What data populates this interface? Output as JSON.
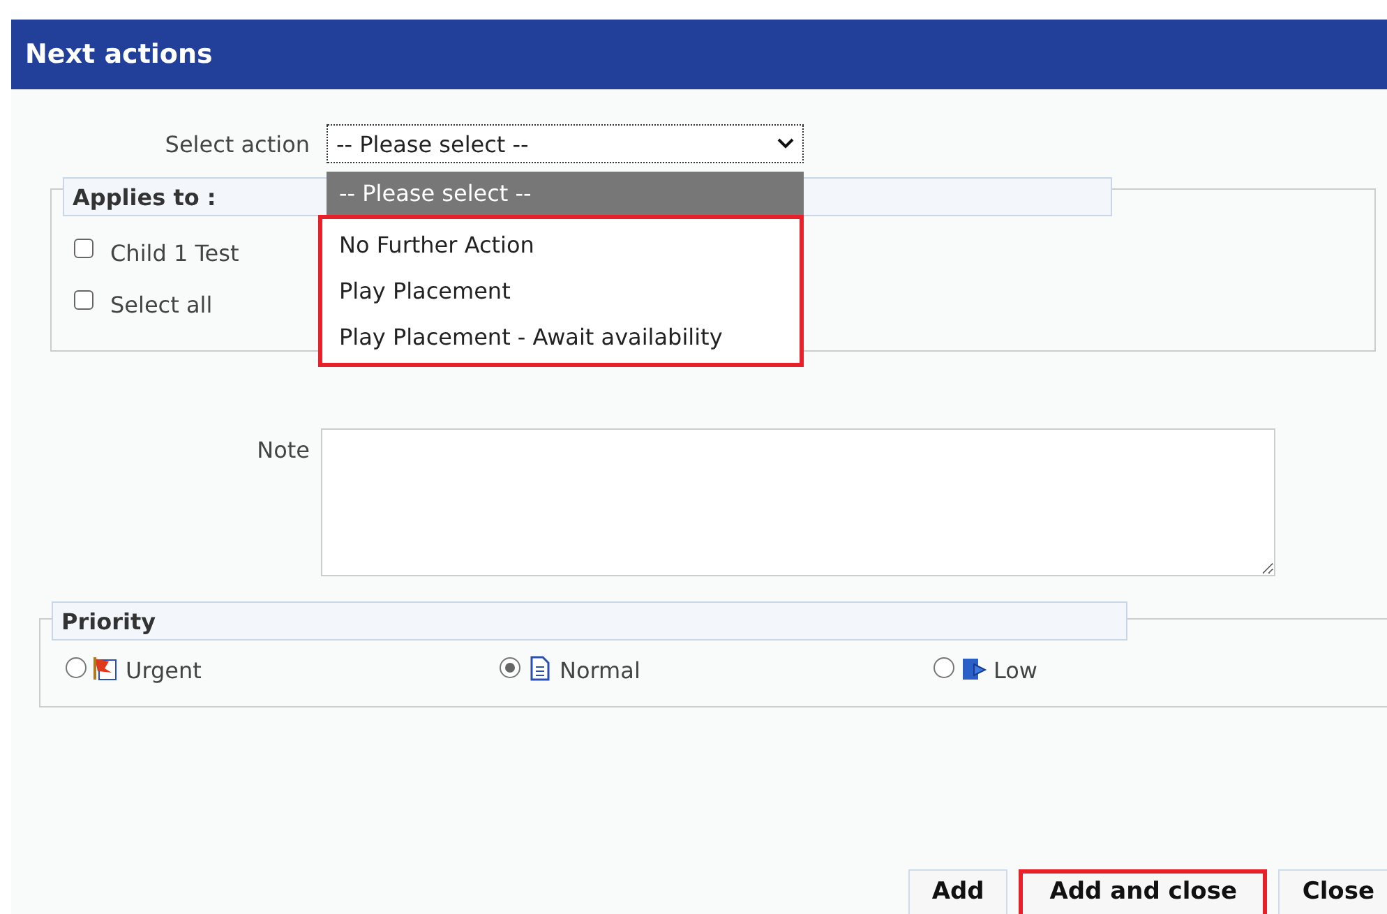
{
  "window": {
    "title": "Next actions"
  },
  "select_action": {
    "label": "Select action",
    "value": "-- Please select --",
    "expanded": true,
    "options": [
      {
        "label": "-- Please select --",
        "selected": true,
        "highlighted": false
      },
      {
        "label": "No Further Action",
        "selected": false,
        "highlighted": true
      },
      {
        "label": "Play Placement",
        "selected": false,
        "highlighted": true
      },
      {
        "label": "Play Placement - Await availability",
        "selected": false,
        "highlighted": true
      }
    ]
  },
  "applies_to": {
    "legend": "Applies to :",
    "items": [
      {
        "label": "Child 1 Test",
        "checked": false
      },
      {
        "label": "Select all",
        "checked": false
      }
    ]
  },
  "note": {
    "label": "Note"
  },
  "priority": {
    "legend": "Priority",
    "options": [
      {
        "label": "Urgent",
        "kind": "urgent",
        "selected": false
      },
      {
        "label": "Normal",
        "kind": "normal",
        "selected": true
      },
      {
        "label": "Low",
        "kind": "low",
        "selected": false
      }
    ]
  },
  "buttons": [
    {
      "label": "Add",
      "highlighted": false
    },
    {
      "label": "Add and close",
      "highlighted": true
    },
    {
      "label": "Close",
      "highlighted": false
    }
  ]
}
